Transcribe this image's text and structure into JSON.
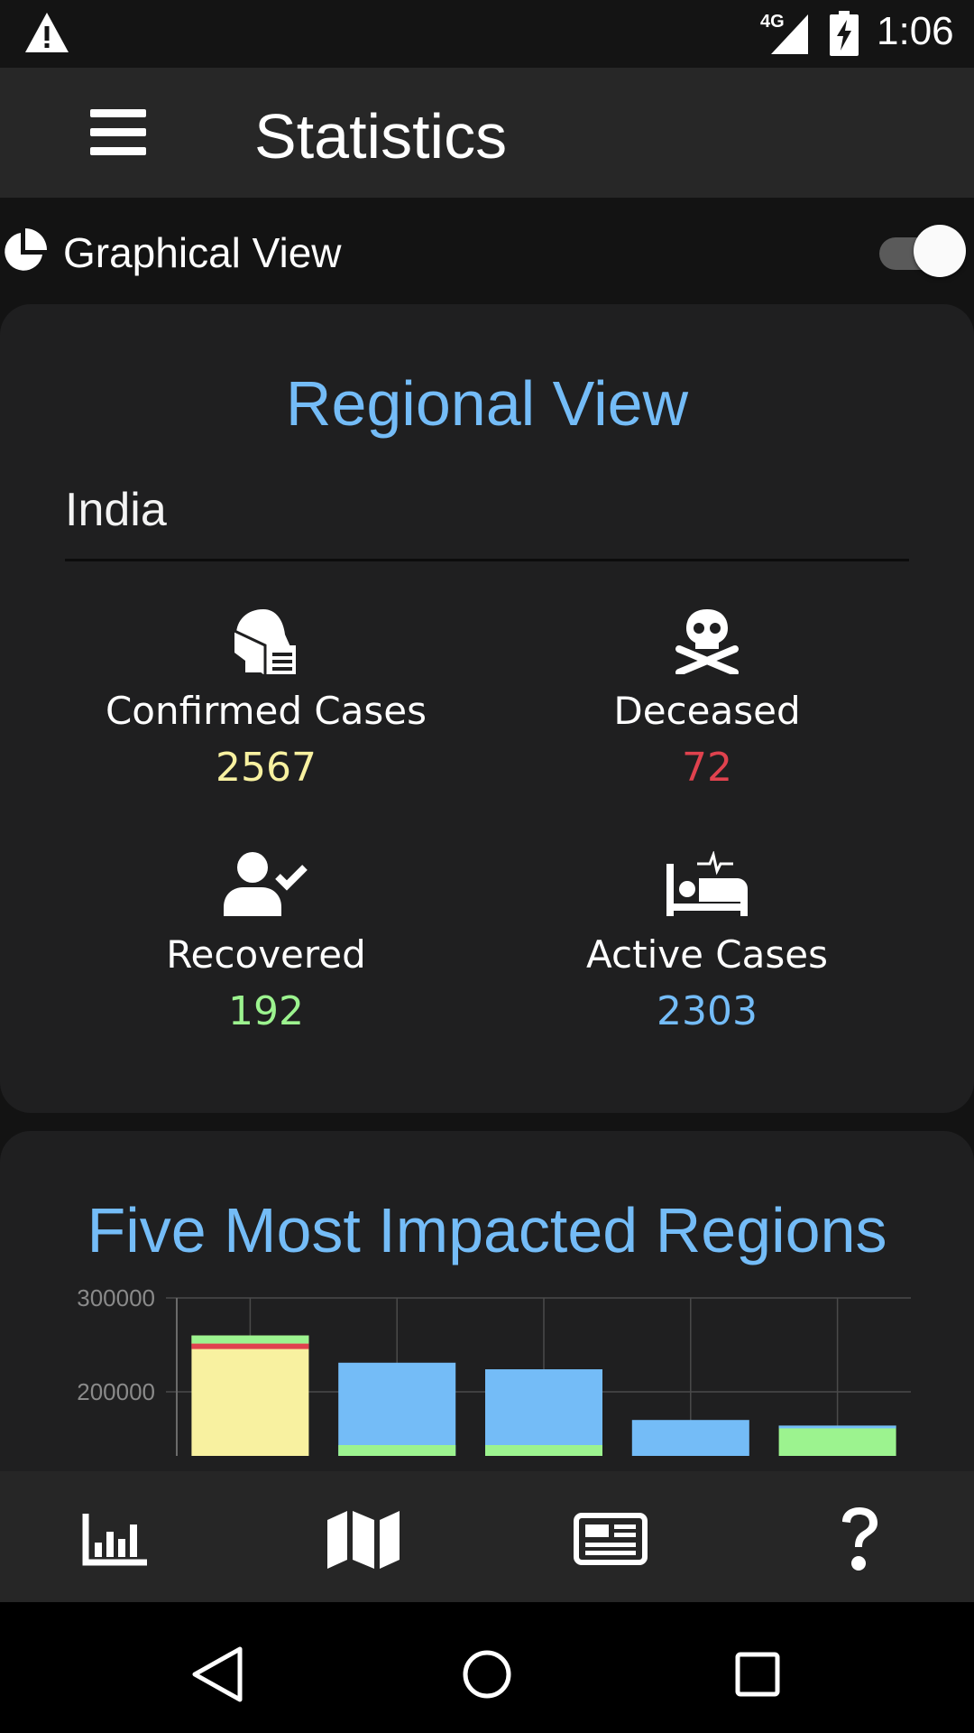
{
  "status_bar": {
    "network": "4G",
    "time": "1:06"
  },
  "app_bar": {
    "title": "Statistics",
    "menu_icon": "hamburger-menu-icon"
  },
  "view_toggle": {
    "label": "Graphical View",
    "icon": "pie-chart-icon",
    "enabled": true
  },
  "regional_card": {
    "title": "Regional View",
    "region": "India",
    "stats": [
      {
        "label": "Confirmed Cases",
        "value": "2567",
        "icon": "head-mask-icon",
        "color": "#f8f1a0"
      },
      {
        "label": "Deceased",
        "value": "72",
        "icon": "skull-crossbones-icon",
        "color": "#e0424e"
      },
      {
        "label": "Recovered",
        "value": "192",
        "icon": "user-check-icon",
        "color": "#9cf38f"
      },
      {
        "label": "Active Cases",
        "value": "2303",
        "icon": "hospital-bed-icon",
        "color": "#74bcf7"
      }
    ]
  },
  "impact_card": {
    "title": "Five Most Impacted Regions"
  },
  "chart_data": {
    "type": "bar",
    "stacked": true,
    "categories": [
      "",
      "",
      "",
      "",
      ""
    ],
    "y_ticks": [
      "300000",
      "200000"
    ],
    "ylim": [
      150000,
      300000
    ],
    "grid": true,
    "series": [
      {
        "color": "#f8f1a0",
        "values": [
          245000,
          0,
          0,
          0,
          0
        ]
      },
      {
        "color": "#74bcf7",
        "values": [
          0,
          217000,
          207000,
          170000,
          0
        ]
      },
      {
        "color": "#9cf38f",
        "values": [
          0,
          0,
          0,
          0,
          0
        ]
      },
      {
        "color": "#e0424e",
        "values": [
          5000,
          0,
          0,
          0,
          0
        ]
      }
    ],
    "totals": [
      260000,
      231000,
      224000,
      170000,
      164000
    ],
    "recovered": [
      0,
      0,
      0,
      0,
      0
    ]
  },
  "bottom_nav": [
    {
      "icon": "bar-chart-icon"
    },
    {
      "icon": "map-icon"
    },
    {
      "icon": "newspaper-icon"
    },
    {
      "icon": "question-mark-icon"
    }
  ],
  "colors": {
    "accent": "#74bcf7",
    "background": "#131313",
    "card": "#1f1f20",
    "appbar": "#272727"
  }
}
